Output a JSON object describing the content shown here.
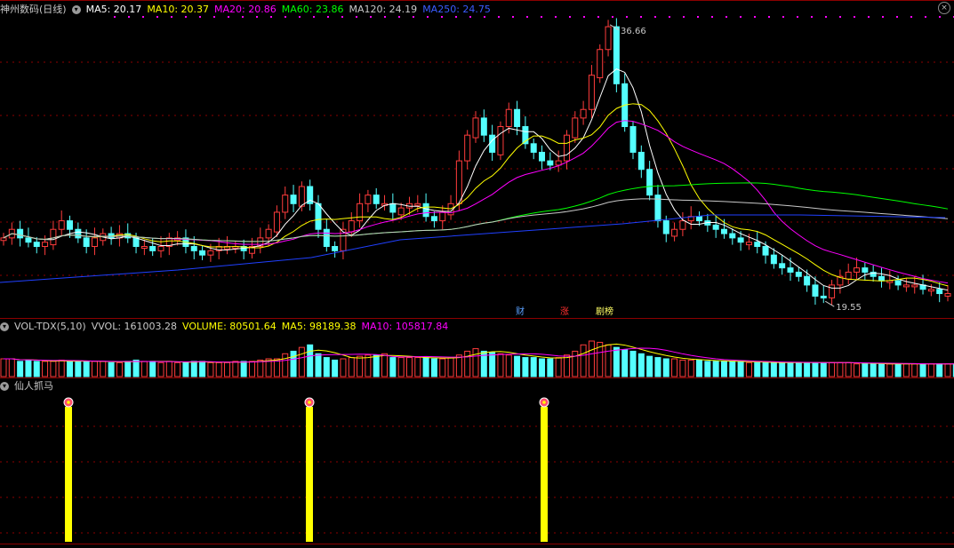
{
  "main_panel": {
    "stock_title": "神州数码(日线)",
    "ma_labels": [
      {
        "text": "MA5: 20.17",
        "color": "#ffffff"
      },
      {
        "text": "MA10: 20.37",
        "color": "#ffff00"
      },
      {
        "text": "MA20: 20.86",
        "color": "#ff00ff"
      },
      {
        "text": "MA60: 23.86",
        "color": "#00ff00"
      },
      {
        "text": "MA120: 24.19",
        "color": "#c8c8c8"
      },
      {
        "text": "MA250: 24.75",
        "color": "#3a5cff"
      }
    ],
    "high_label": "36.66",
    "low_label": "19.55",
    "event_tags": [
      {
        "text": "财",
        "color": "#5aa0ff"
      },
      {
        "text": "涨",
        "color": "#ff3030"
      },
      {
        "text": "剧榜",
        "color": "#ffff66"
      }
    ]
  },
  "volume_panel": {
    "indicator": "VOL-TDX(5,10)",
    "items": [
      {
        "text": "VVOL: 161003.28",
        "color": "#c8c8c8"
      },
      {
        "text": "VOLUME: 80501.64",
        "color": "#ffff00"
      },
      {
        "text": "MA5: 98189.38",
        "color": "#ffff00"
      },
      {
        "text": "MA10: 105817.84",
        "color": "#ff00ff"
      }
    ]
  },
  "indicator_panel": {
    "name": "仙人抓马",
    "signal_icon": "flower-icon",
    "signal_bar_color": "#ffff00"
  },
  "colors": {
    "up": "#ff3c3c",
    "down": "#54ffff",
    "grid": "#8b0000"
  },
  "chart_data": {
    "type": "candlestick",
    "price_series": [
      12,
      13,
      12,
      11.5,
      11,
      11.5,
      13,
      14,
      13,
      12,
      11,
      12,
      12.5,
      12,
      12.5,
      12,
      11,
      11,
      10.5,
      11,
      12,
      12,
      11,
      10.5,
      10,
      10.5,
      11,
      11,
      11,
      10.5,
      11,
      12,
      13,
      15,
      17,
      16,
      18,
      16,
      13,
      11,
      10.5,
      13,
      14,
      16,
      17,
      16,
      16,
      15,
      15.5,
      16,
      16,
      14.5,
      14,
      15,
      16,
      21,
      24,
      26,
      24,
      22,
      25,
      27,
      25,
      23,
      22,
      21,
      20.5,
      21,
      24,
      26,
      27,
      31,
      34,
      36.66,
      30,
      25,
      22,
      20,
      17,
      14,
      12.5,
      13,
      14,
      14.5,
      14,
      13.5,
      13,
      12.5,
      12,
      11.5,
      11.5,
      11,
      10,
      9,
      8.5,
      8,
      7.5,
      6.5,
      5.2,
      5,
      6.5,
      7.5,
      8,
      8.5,
      8,
      7.5,
      7,
      7,
      6.5,
      6.5,
      6.5,
      6,
      6,
      5.5,
      5.5
    ],
    "price_range": [
      19.55,
      36.66
    ],
    "ma_lines": [
      "MA5",
      "MA10",
      "MA20",
      "MA60",
      "MA120",
      "MA250"
    ],
    "signal_positions_fraction": [
      0.072,
      0.324,
      0.57
    ],
    "volume_series": [
      14,
      14,
      12,
      13,
      12,
      12,
      12,
      13,
      12,
      12,
      12,
      12,
      12,
      11,
      11,
      12,
      13,
      12,
      12,
      11,
      12,
      11,
      11,
      12,
      12,
      11,
      11,
      11,
      12,
      12,
      12,
      13,
      14,
      14,
      18,
      20,
      23,
      25,
      18,
      15,
      13,
      14,
      15,
      16,
      17,
      17,
      18,
      15,
      15,
      15,
      15,
      15,
      14,
      14,
      15,
      17,
      20,
      22,
      20,
      19,
      18,
      17,
      16,
      15,
      15,
      14,
      14,
      15,
      17,
      20,
      25,
      28,
      27,
      25,
      23,
      21,
      20,
      18,
      16,
      15,
      14,
      14,
      13,
      13,
      13,
      12,
      12,
      12,
      12,
      12,
      11,
      11,
      11,
      11,
      11,
      11,
      11,
      11,
      11,
      11,
      11,
      11,
      11,
      10,
      10,
      10,
      10,
      10,
      10,
      10,
      10,
      10,
      10,
      10,
      10,
      10,
      10
    ]
  }
}
